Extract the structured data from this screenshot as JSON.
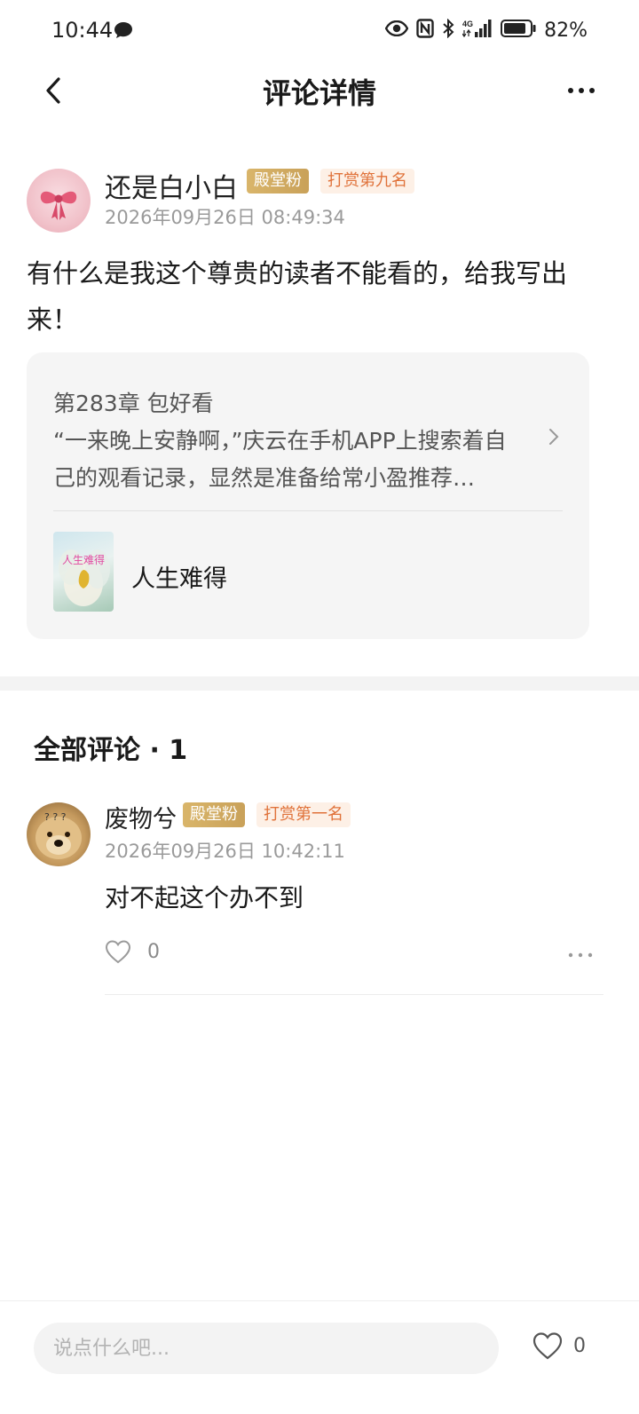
{
  "status_bar": {
    "time": "10:44",
    "battery": "82%",
    "icons": [
      "chat-bubble-icon",
      "eye-icon",
      "nfc-icon",
      "bluetooth-icon",
      "signal-4g-icon",
      "battery-icon"
    ]
  },
  "header": {
    "title": "评论详情",
    "back_icon": "chevron-left-icon",
    "more_icon": "more-horizontal-icon"
  },
  "main_comment": {
    "username": "还是白小白",
    "badge_fan": "殿堂粉",
    "badge_reward": "打赏第九名",
    "timestamp": "2026年09月26日 08:49:34",
    "content": "有什么是我这个尊贵的读者不能看的，给我写出来！"
  },
  "quote_card": {
    "chapter_title": "第283章 包好看",
    "excerpt": "“一来晚上安静啊，”庆云在手机APP上搜索着自己的观看记录，显然是准备给常小盈推荐…",
    "book_name": "人生难得",
    "cover_text": "人生难得"
  },
  "replies_section": {
    "title": "全部评论 · 1"
  },
  "replies": [
    {
      "username": "废物兮",
      "badge_fan": "殿堂粉",
      "badge_reward": "打赏第一名",
      "timestamp": "2026年09月26日 10:42:11",
      "content": "对不起这个办不到",
      "like_count": "0"
    }
  ],
  "bottom_bar": {
    "input_placeholder": "说点什么吧...",
    "like_count": "0"
  },
  "colors": {
    "fan_badge": "#c9a159",
    "reward_badge_text": "#e0723a",
    "reward_badge_bg": "#fdf0e6",
    "card_bg": "#f5f5f5"
  }
}
